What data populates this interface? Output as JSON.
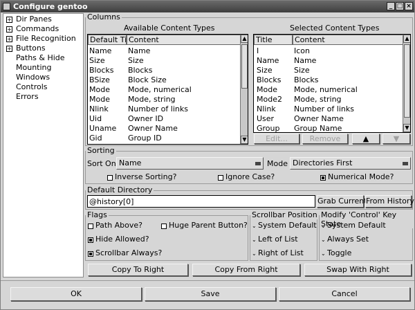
{
  "window": {
    "title": "Configure gentoo"
  },
  "tree": [
    {
      "label": "Dir Panes",
      "expandable": true
    },
    {
      "label": "Commands",
      "expandable": true
    },
    {
      "label": "File Recognition",
      "expandable": true
    },
    {
      "label": "Buttons",
      "expandable": true
    },
    {
      "label": "Paths & Hide",
      "expandable": false
    },
    {
      "label": "Mounting",
      "expandable": false
    },
    {
      "label": "Windows",
      "expandable": false
    },
    {
      "label": "Controls",
      "expandable": false
    },
    {
      "label": "Errors",
      "expandable": false
    }
  ],
  "columns": {
    "group_label": "Columns",
    "available": {
      "heading": "Available Content Types",
      "headers": [
        "Default Title",
        "Content"
      ],
      "rows": [
        [
          "Name",
          "Name"
        ],
        [
          "Size",
          "Size"
        ],
        [
          "Blocks",
          "Blocks"
        ],
        [
          "BSize",
          "Block Size"
        ],
        [
          "Mode",
          "Mode, numerical"
        ],
        [
          "Mode",
          "Mode, string"
        ],
        [
          "Nlink",
          "Number of links"
        ],
        [
          "Uid",
          "Owner ID"
        ],
        [
          "Uname",
          "Owner Name"
        ],
        [
          "Gid",
          "Group ID"
        ]
      ]
    },
    "selected": {
      "heading": "Selected Content Types",
      "headers": [
        "Title",
        "Content"
      ],
      "rows": [
        [
          "I",
          "Icon"
        ],
        [
          "Name",
          "Name"
        ],
        [
          "Size",
          "Size"
        ],
        [
          "Blocks",
          "Blocks"
        ],
        [
          "Mode",
          "Mode, numerical"
        ],
        [
          "Mode2",
          "Mode, string"
        ],
        [
          "Nlink",
          "Number of links"
        ],
        [
          "User",
          "Owner Name"
        ],
        [
          "Group",
          "Group Name"
        ]
      ]
    },
    "edit_label": "Edit...",
    "remove_label": "Remove",
    "up_glyph": "▲",
    "down_glyph": "▼"
  },
  "sorting": {
    "group_label": "Sorting",
    "sort_on_label": "Sort On",
    "sort_on_value": "Name",
    "mode_label": "Mode",
    "mode_value": "Directories First",
    "inverse_label": "Inverse Sorting?",
    "ignore_case_label": "Ignore Case?",
    "numerical_label": "Numerical Mode?",
    "numerical_checked": true
  },
  "default_dir": {
    "group_label": "Default Directory",
    "value": "@history[0]",
    "grab_label": "Grab Current",
    "history_label": "From History"
  },
  "flags": {
    "group_label": "Flags",
    "path_above": "Path Above?",
    "huge_parent": "Huge Parent Button?",
    "hide_allowed": "Hide Allowed?",
    "scrollbar_always": "Scrollbar Always?"
  },
  "scrollbar_pos": {
    "group_label": "Scrollbar Position",
    "options": [
      "System Default",
      "Left of List",
      "Right of List"
    ]
  },
  "control_key": {
    "group_label": "Modify 'Control' Key State",
    "options": [
      "System Default",
      "Always Set",
      "Toggle"
    ]
  },
  "copy": {
    "to_right": "Copy To Right",
    "from_right": "Copy From Right",
    "swap": "Swap With Right"
  },
  "dialog": {
    "ok": "OK",
    "save": "Save",
    "cancel": "Cancel"
  }
}
